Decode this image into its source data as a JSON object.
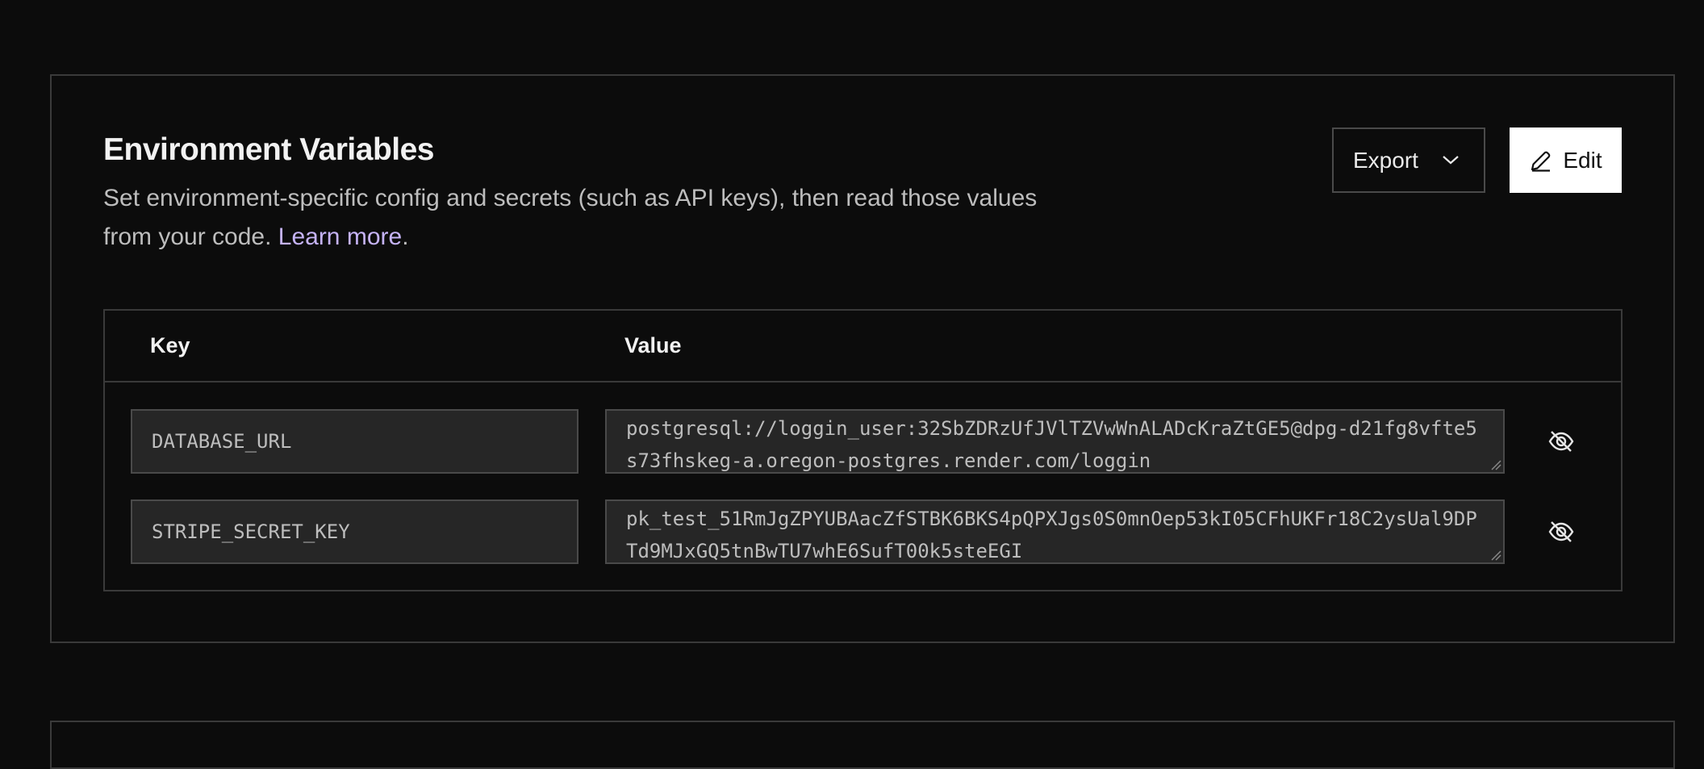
{
  "section": {
    "title": "Environment Variables",
    "description": "Set environment-specific config and secrets (such as API keys), then read those values from your code. ",
    "learn_more": "Learn more",
    "period": "."
  },
  "actions": {
    "export_label": "Export",
    "edit_label": "Edit"
  },
  "table": {
    "headers": {
      "key": "Key",
      "value": "Value"
    },
    "rows": [
      {
        "key": "DATABASE_URL",
        "value": "postgresql://loggin_user:32SbZDRzUfJVlTZVwWnALADcKraZtGE5@dpg-d21fg8vfte5s73fhskeg-a.oregon-postgres.render.com/loggin"
      },
      {
        "key": "STRIPE_SECRET_KEY",
        "value": "pk_test_51RmJgZPYUBAacZfSTBK6BKS4pQPXJgs0S0mnOep53kI05CFhUKFr18C2ysUal9DPTd9MJxGQ5tnBwTU7whE6SufT00k5steEGI"
      }
    ]
  },
  "icons": {
    "export_dropdown": "chevron-down-icon",
    "edit": "pencil-icon",
    "visibility": "eye-off-icon"
  },
  "colors": {
    "background": "#0c0c0c",
    "border": "#3a3a3a",
    "field_bg": "#262626",
    "link": "#c5b3f5",
    "edit_button_bg": "#ffffff"
  }
}
